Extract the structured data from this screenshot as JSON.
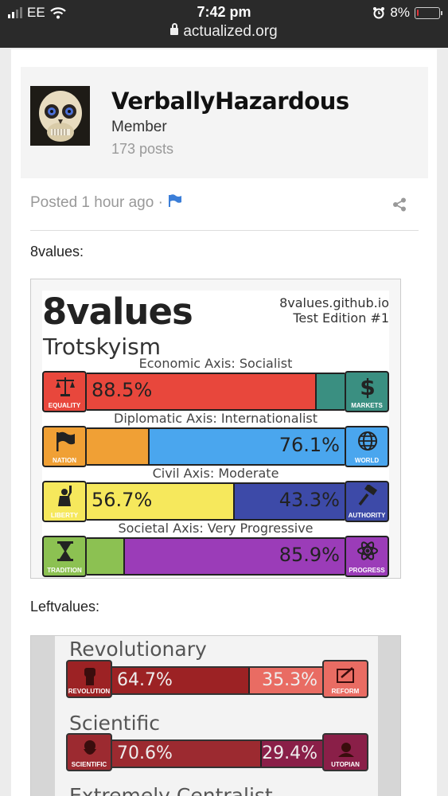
{
  "status_bar": {
    "carrier": "EE",
    "time": "7:42 pm",
    "battery_percent": "8%",
    "battery_level": 0.08
  },
  "browser": {
    "url": "actualized.org"
  },
  "profile": {
    "username": "VerballyHazardous",
    "role": "Member",
    "posts": "173 posts"
  },
  "post": {
    "posted_text": "Posted 1 hour ago ·",
    "label_8values": "8values:",
    "label_leftvalues": "Leftvalues:"
  },
  "eightvalues": {
    "title": "8values",
    "ideology": "Trotskyism",
    "site": "8values.github.io",
    "edition": "Test Edition #1",
    "axes": [
      {
        "title": "Economic Axis: Socialist",
        "left_label": "EQUALITY",
        "right_label": "MARKETS",
        "left_value": 88.5,
        "right_value": 11.5,
        "left_pct_text": "88.5%",
        "right_pct_text": "",
        "left_color": "#e8473c",
        "right_color": "#3a8f81",
        "left_icon_bg": "#e8473c",
        "right_icon_bg": "#3a8f81",
        "left_icon": "scales-icon",
        "right_icon": "dollar-icon"
      },
      {
        "title": "Diplomatic Axis: Internationalist",
        "left_label": "NATION",
        "right_label": "WORLD",
        "left_value": 23.9,
        "right_value": 76.1,
        "left_pct_text": "",
        "right_pct_text": "76.1%",
        "left_color": "#f0a035",
        "right_color": "#4aa6ee",
        "left_icon_bg": "#f0a035",
        "right_icon_bg": "#4aa6ee",
        "left_icon": "flag-icon",
        "right_icon": "globe-icon"
      },
      {
        "title": "Civil Axis: Moderate",
        "left_label": "LIBERTY",
        "right_label": "AUTHORITY",
        "left_value": 56.7,
        "right_value": 43.3,
        "left_pct_text": "56.7%",
        "right_pct_text": "43.3%",
        "left_color": "#f6e85c",
        "right_color": "#3d4aa8",
        "left_icon_bg": "#f6e85c",
        "right_icon_bg": "#3d4aa8",
        "left_icon": "statue-of-liberty-icon",
        "right_icon": "gavel-icon"
      },
      {
        "title": "Societal Axis: Very Progressive",
        "left_label": "TRADITION",
        "right_label": "PROGRESS",
        "left_value": 14.1,
        "right_value": 85.9,
        "left_pct_text": "",
        "right_pct_text": "85.9%",
        "left_color": "#8cc152",
        "right_color": "#9b3cb8",
        "left_icon_bg": "#8cc152",
        "right_icon_bg": "#9b3cb8",
        "left_icon": "hourglass-icon",
        "right_icon": "atom-icon"
      }
    ]
  },
  "leftvalues": {
    "axes": [
      {
        "title": "Revolutionary",
        "left_label": "REVOLUTION",
        "right_label": "REFORM",
        "left_value": 64.7,
        "right_value": 35.3,
        "left_pct_text": "64.7%",
        "right_pct_text": "35.3%",
        "left_color": "#9c2224",
        "right_color": "#e96c63",
        "left_icon": "fist-icon",
        "right_icon": "ballot-icon"
      },
      {
        "title": "Scientific",
        "left_label": "SCIENTIFIC",
        "right_label": "UTOPIAN",
        "left_value": 70.6,
        "right_value": 29.4,
        "left_pct_text": "70.6%",
        "right_pct_text": "29.4%",
        "left_color": "#9c2a30",
        "right_color": "#8a1f48",
        "left_icon": "marx-portrait-icon",
        "right_icon": "utopia-icon"
      }
    ],
    "partial_title": "Extremely Centralist"
  }
}
